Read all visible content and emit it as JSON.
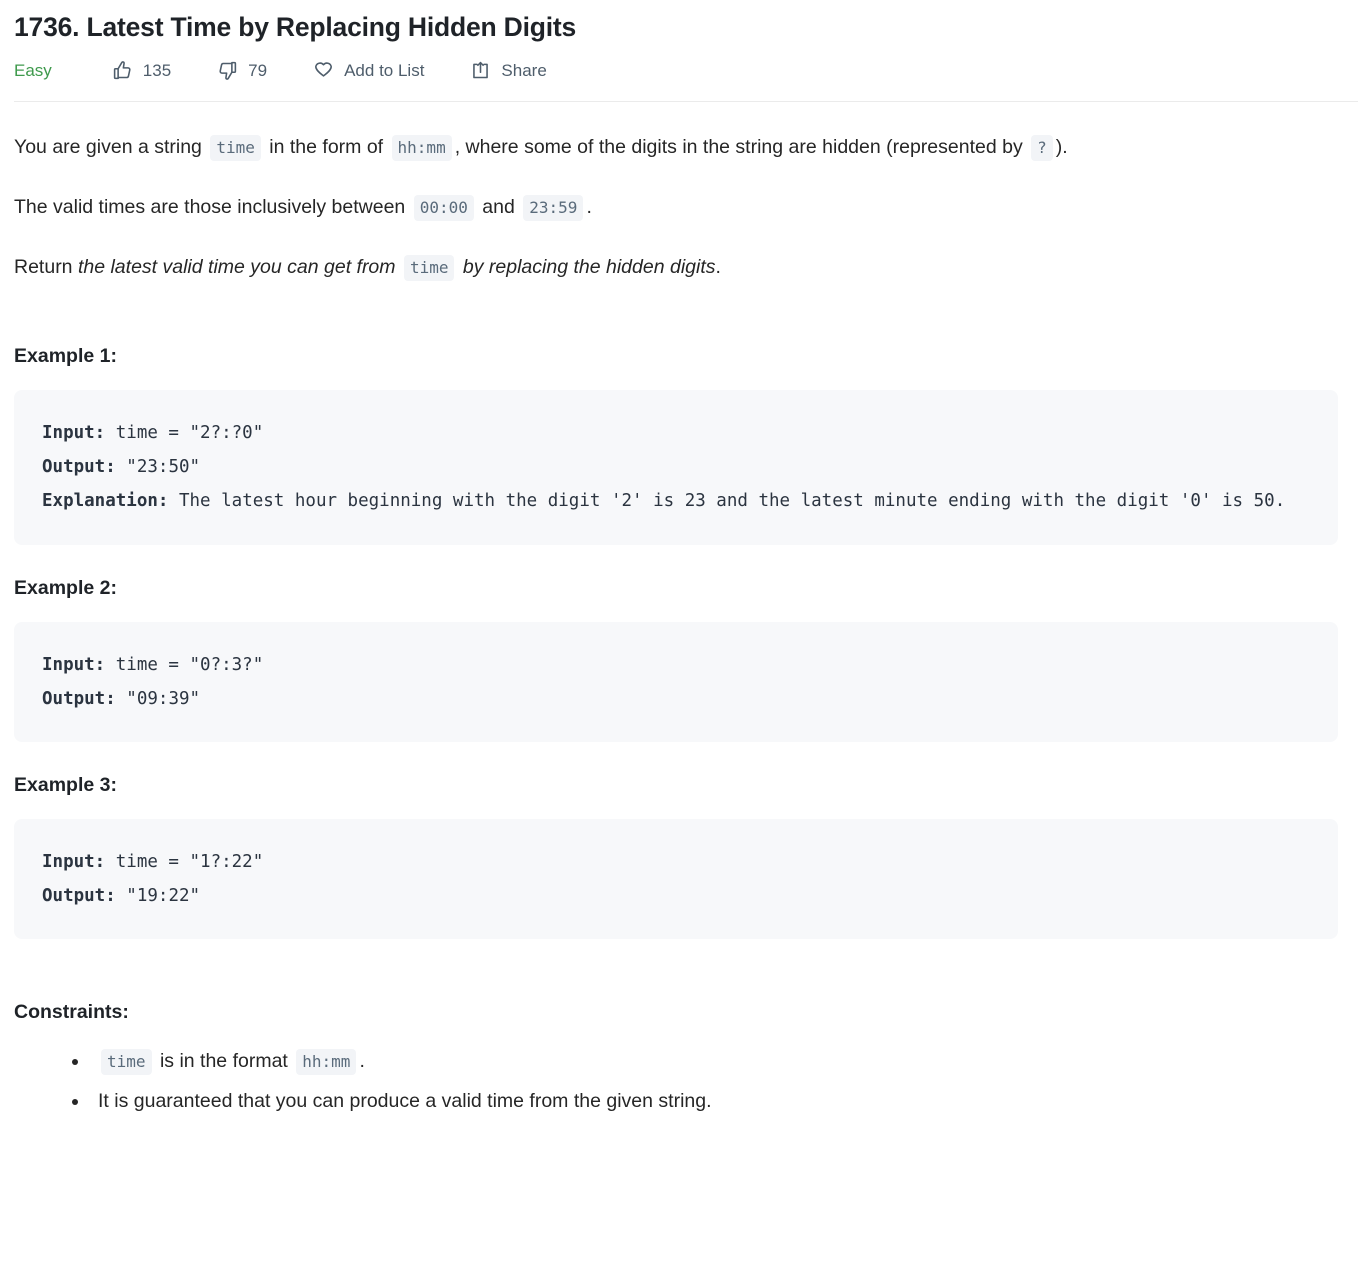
{
  "problem": {
    "title": "1736. Latest Time by Replacing Hidden Digits",
    "difficulty": "Easy"
  },
  "actions": {
    "likes": "135",
    "dislikes": "79",
    "add_to_list": "Add to List",
    "share": "Share"
  },
  "description": {
    "p1_a": "You are given a string",
    "p1_code1": "time",
    "p1_b": "in the form of",
    "p1_code2": "hh:mm",
    "p1_c": ", where some of the digits in the string are hidden (represented by",
    "p1_code3": "?",
    "p1_d": ").",
    "p2_a": "The valid times are those inclusively between",
    "p2_code1": "00:00",
    "p2_b": "and",
    "p2_code2": "23:59",
    "p2_c": ".",
    "p3_a": "Return",
    "p3_em1": "the latest valid time you can get from",
    "p3_code1": "time",
    "p3_em2": "by replacing the hidden digits",
    "p3_b": "."
  },
  "examples": [
    {
      "heading": "Example 1:",
      "input_label": "Input:",
      "input_value": " time = \"2?:?0\"",
      "output_label": "Output:",
      "output_value": " \"23:50\"",
      "explanation_label": "Explanation:",
      "explanation_value": " The latest hour beginning with the digit '2' is 23 and the latest minute ending with the digit '0' is 50."
    },
    {
      "heading": "Example 2:",
      "input_label": "Input:",
      "input_value": " time = \"0?:3?\"",
      "output_label": "Output:",
      "output_value": " \"09:39\"",
      "explanation_label": "",
      "explanation_value": ""
    },
    {
      "heading": "Example 3:",
      "input_label": "Input:",
      "input_value": " time = \"1?:22\"",
      "output_label": "Output:",
      "output_value": " \"19:22\"",
      "explanation_label": "",
      "explanation_value": ""
    }
  ],
  "constraints": {
    "heading": "Constraints:",
    "item1_code1": "time",
    "item1_a": "is in the format",
    "item1_code2": "hh:mm",
    "item1_b": ".",
    "item2": "It is guaranteed that you can produce a valid time from the given string."
  },
  "colors": {
    "easy_green": "#3f9a4d",
    "icon_gray": "#4e5d6b",
    "code_bg": "#f7f8fa",
    "inline_code_bg": "#f2f4f7"
  }
}
